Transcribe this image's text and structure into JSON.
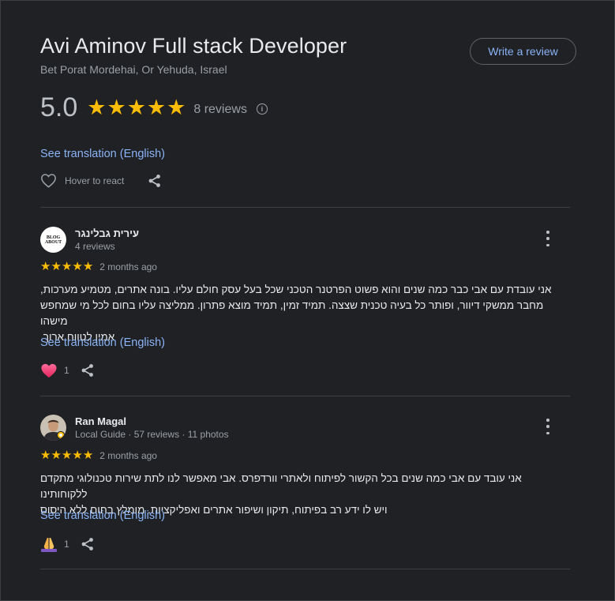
{
  "place": {
    "title": "Avi Aminov Full stack Developer",
    "address": "Bet Porat Mordehai, Or Yehuda, Israel",
    "write_review_label": "Write a review",
    "rating": "5.0",
    "review_count_label": "8 reviews",
    "see_translation_label": "See translation (English)",
    "hover_to_react_label": "Hover to react"
  },
  "reviews": [
    {
      "name": "עירית גבלינגר",
      "meta": "4 reviews",
      "avatar_text": [
        "BLOG",
        "ABOUT"
      ],
      "stars": 5,
      "time": "2 months ago",
      "text": [
        "אני עובדת עם אבי כבר כמה שנים והוא פשוט הפרטנר הטכני שכל בעל עסק חולם עליו. בונה אתרים, מטמיע מערכות,",
        "מחבר ממשקי דיוור, ופותר כל בעיה טכנית שצצה. תמיד זמין, תמיד מוצא פתרון. ממליצה עליו בחום לכל מי שמחפש מישהו",
        "אמין לטווח ארוך."
      ],
      "see_translation_label": "See translation (English)",
      "reaction_icon": "heart-emoji-icon",
      "reaction_count": "1"
    },
    {
      "name": "Ran Magal",
      "meta": "Local Guide · 57 reviews · 11 photos",
      "stars": 5,
      "time": "2 months ago",
      "text": [
        "אני עובד עם אבי כמה שנים בכל הקשור לפיתוח ולאתרי וורדפרס. אבי מאפשר לנו לתת שירות טכנולוגי מתקדם ללקוחותינו",
        "ויש לו ידע רב בפיתוח, תיקון ושיפור אתרים ואפליקציות. מומלץ בחום ללא היסוס"
      ],
      "see_translation_label": "See translation (English)",
      "reaction_icon": "praying-hands-emoji-icon",
      "reaction_count": "1"
    }
  ],
  "colors": {
    "background": "#202124",
    "star": "#fbbc04",
    "link": "#8ab4f8",
    "muted_text": "#9aa0a6",
    "divider": "#3c4043"
  }
}
